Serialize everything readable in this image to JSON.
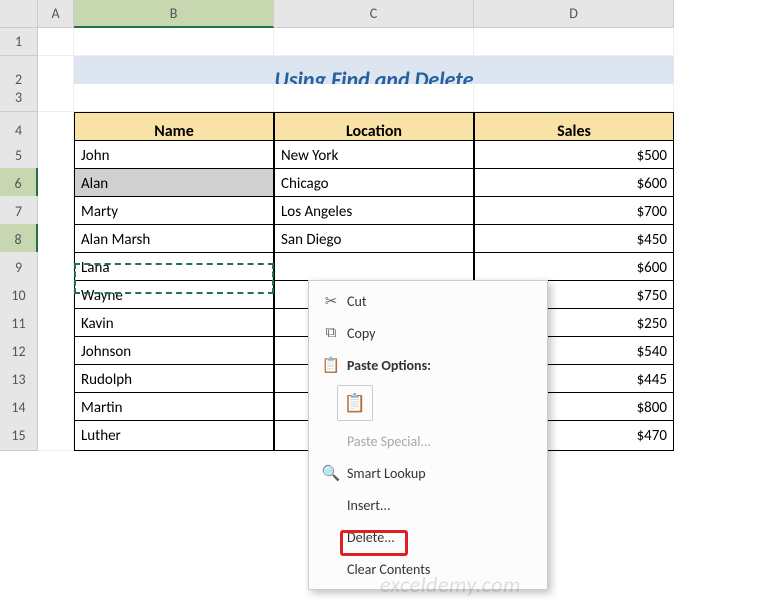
{
  "columns": [
    "A",
    "B",
    "C",
    "D"
  ],
  "rows": [
    "1",
    "2",
    "3",
    "4",
    "5",
    "6",
    "7",
    "8",
    "9",
    "10",
    "11",
    "12",
    "13",
    "14",
    "15"
  ],
  "title": "Using Find and Delete",
  "headers": {
    "name": "Name",
    "location": "Location",
    "sales": "Sales"
  },
  "data": [
    {
      "name": "John",
      "location": "New York",
      "sales": "$500"
    },
    {
      "name": "Alan",
      "location": "Chicago",
      "sales": "$600"
    },
    {
      "name": "Marty",
      "location": "Los Angeles",
      "sales": "$700"
    },
    {
      "name": "Alan Marsh",
      "location": "San Diego",
      "sales": "$450"
    },
    {
      "name": "Lana",
      "location": "",
      "sales": "$600"
    },
    {
      "name": "Wayne",
      "location": "",
      "sales": "$750"
    },
    {
      "name": "Kavin",
      "location": "",
      "sales": "$250"
    },
    {
      "name": "Johnson",
      "location": "",
      "sales": "$540"
    },
    {
      "name": "Rudolph",
      "location": "",
      "sales": "$445"
    },
    {
      "name": "Martin",
      "location": "",
      "sales": "$800"
    },
    {
      "name": "Luther",
      "location": "",
      "sales": "$470"
    }
  ],
  "context_menu": {
    "cut": "Cut",
    "copy": "Copy",
    "paste_options": "Paste Options:",
    "paste_special": "Paste Special...",
    "smart_lookup": "Smart Lookup",
    "insert": "Insert...",
    "delete": "Delete...",
    "clear_contents": "Clear Contents"
  },
  "watermark": "exceldemy.com"
}
